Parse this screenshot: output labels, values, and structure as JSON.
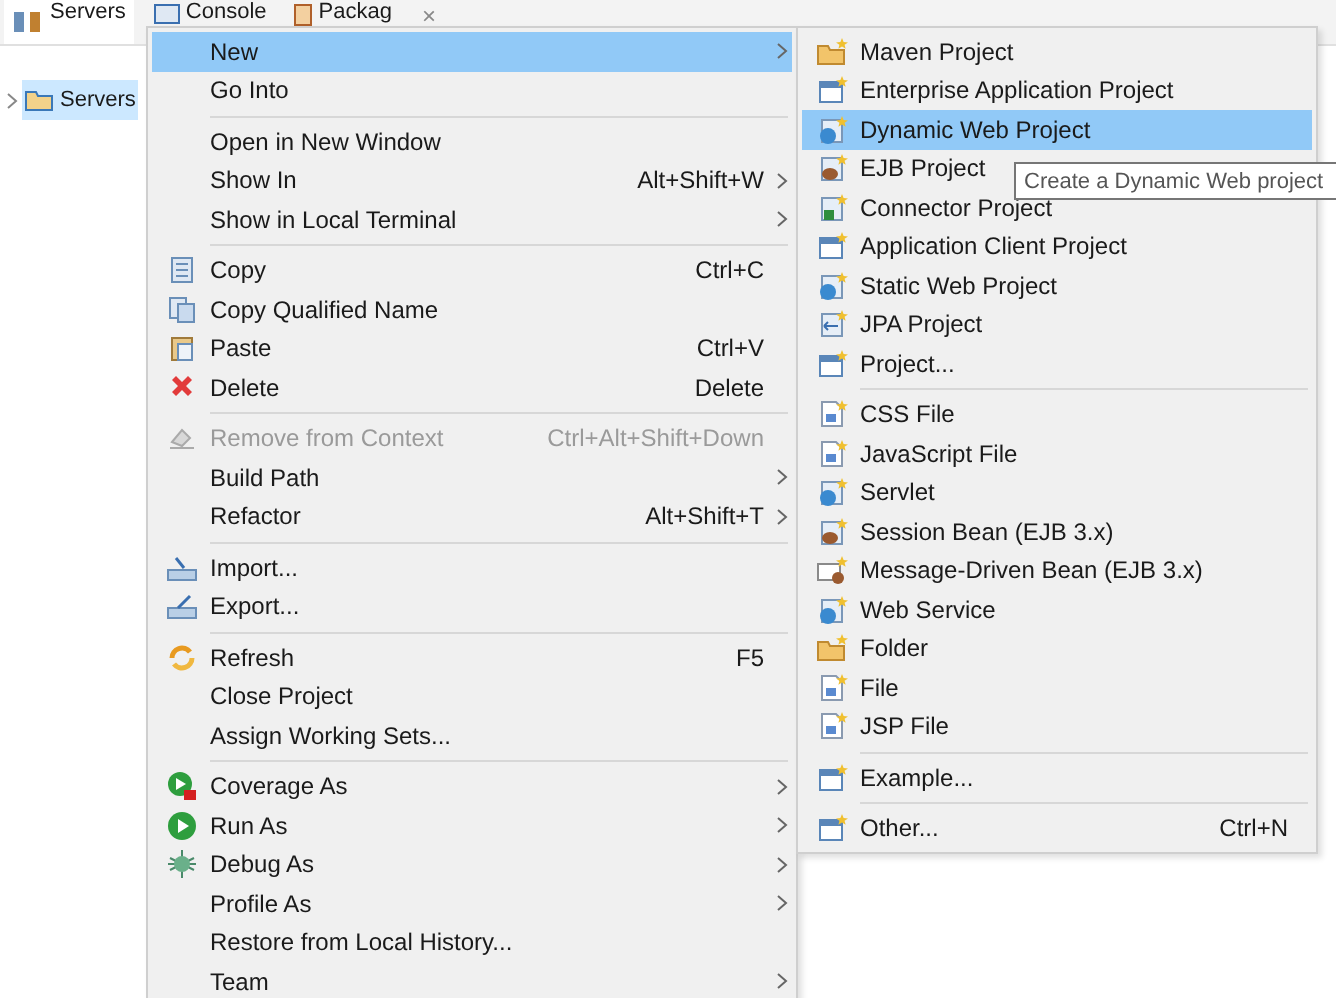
{
  "tabs": [
    {
      "label": "Servers",
      "selected": true
    },
    {
      "label": "Console",
      "selected": false
    },
    {
      "label": "Packag",
      "selected": false
    }
  ],
  "tab_close": "×",
  "tree": {
    "items": [
      {
        "label": "Servers",
        "selected": true,
        "expanded": false
      }
    ]
  },
  "context_menu": {
    "sections": [
      [
        {
          "label": "New",
          "submenu": true,
          "disabled": false,
          "selected": true
        },
        {
          "label": "Go Into",
          "submenu": false,
          "disabled": false,
          "selected": false
        }
      ],
      [
        {
          "label": "Open in New Window",
          "submenu": false,
          "disabled": false,
          "selected": false
        },
        {
          "label": "Show In",
          "shortcut": "Alt+Shift+W",
          "submenu": true,
          "disabled": false,
          "selected": false
        },
        {
          "label": "Show in Local Terminal",
          "submenu": true,
          "disabled": false,
          "selected": false
        }
      ],
      [
        {
          "label": "Copy",
          "shortcut": "Ctrl+C",
          "submenu": false,
          "disabled": false,
          "selected": false
        },
        {
          "label": "Copy Qualified Name",
          "submenu": false,
          "disabled": false,
          "selected": false
        },
        {
          "label": "Paste",
          "shortcut": "Ctrl+V",
          "submenu": false,
          "disabled": false,
          "selected": false
        },
        {
          "label": "Delete",
          "shortcut": "Delete",
          "submenu": false,
          "disabled": false,
          "selected": false
        }
      ],
      [
        {
          "label": "Remove from Context",
          "shortcut": "Ctrl+Alt+Shift+Down",
          "submenu": false,
          "disabled": true,
          "selected": false
        },
        {
          "label": "Build Path",
          "submenu": true,
          "disabled": false,
          "selected": false
        },
        {
          "label": "Refactor",
          "shortcut": "Alt+Shift+T",
          "submenu": true,
          "disabled": false,
          "selected": false
        }
      ],
      [
        {
          "label": "Import...",
          "submenu": false,
          "disabled": false,
          "selected": false
        },
        {
          "label": "Export...",
          "submenu": false,
          "disabled": false,
          "selected": false
        }
      ],
      [
        {
          "label": "Refresh",
          "shortcut": "F5",
          "submenu": false,
          "disabled": false,
          "selected": false
        },
        {
          "label": "Close Project",
          "submenu": false,
          "disabled": false,
          "selected": false
        },
        {
          "label": "Assign Working Sets...",
          "submenu": false,
          "disabled": false,
          "selected": false
        }
      ],
      [
        {
          "label": "Coverage As",
          "submenu": true,
          "disabled": false,
          "selected": false
        },
        {
          "label": "Run As",
          "submenu": true,
          "disabled": false,
          "selected": false
        },
        {
          "label": "Debug As",
          "submenu": true,
          "disabled": false,
          "selected": false
        },
        {
          "label": "Profile As",
          "submenu": true,
          "disabled": false,
          "selected": false
        },
        {
          "label": "Restore from Local History...",
          "submenu": false,
          "disabled": false,
          "selected": false
        },
        {
          "label": "Team",
          "submenu": true,
          "disabled": false,
          "selected": false
        }
      ]
    ]
  },
  "submenu": {
    "sections": [
      [
        {
          "label": "Maven Project",
          "selected": false
        },
        {
          "label": "Enterprise Application Project",
          "selected": false
        },
        {
          "label": "Dynamic Web Project",
          "selected": true
        },
        {
          "label": "EJB Project",
          "selected": false
        },
        {
          "label": "Connector Project",
          "selected": false
        },
        {
          "label": "Application Client Project",
          "selected": false
        },
        {
          "label": "Static Web Project",
          "selected": false
        },
        {
          "label": "JPA Project",
          "selected": false
        },
        {
          "label": "Project...",
          "selected": false
        }
      ],
      [
        {
          "label": "CSS File",
          "selected": false
        },
        {
          "label": "JavaScript File",
          "selected": false
        },
        {
          "label": "Servlet",
          "selected": false
        },
        {
          "label": "Session Bean (EJB 3.x)",
          "selected": false
        },
        {
          "label": "Message-Driven Bean (EJB 3.x)",
          "selected": false
        },
        {
          "label": "Web Service",
          "selected": false
        },
        {
          "label": "Folder",
          "selected": false
        },
        {
          "label": "File",
          "selected": false
        },
        {
          "label": "JSP File",
          "selected": false
        }
      ],
      [
        {
          "label": "Example...",
          "selected": false
        }
      ],
      [
        {
          "label": "Other...",
          "shortcut": "Ctrl+N",
          "selected": false
        }
      ]
    ]
  },
  "tooltip": "Create a Dynamic Web project"
}
